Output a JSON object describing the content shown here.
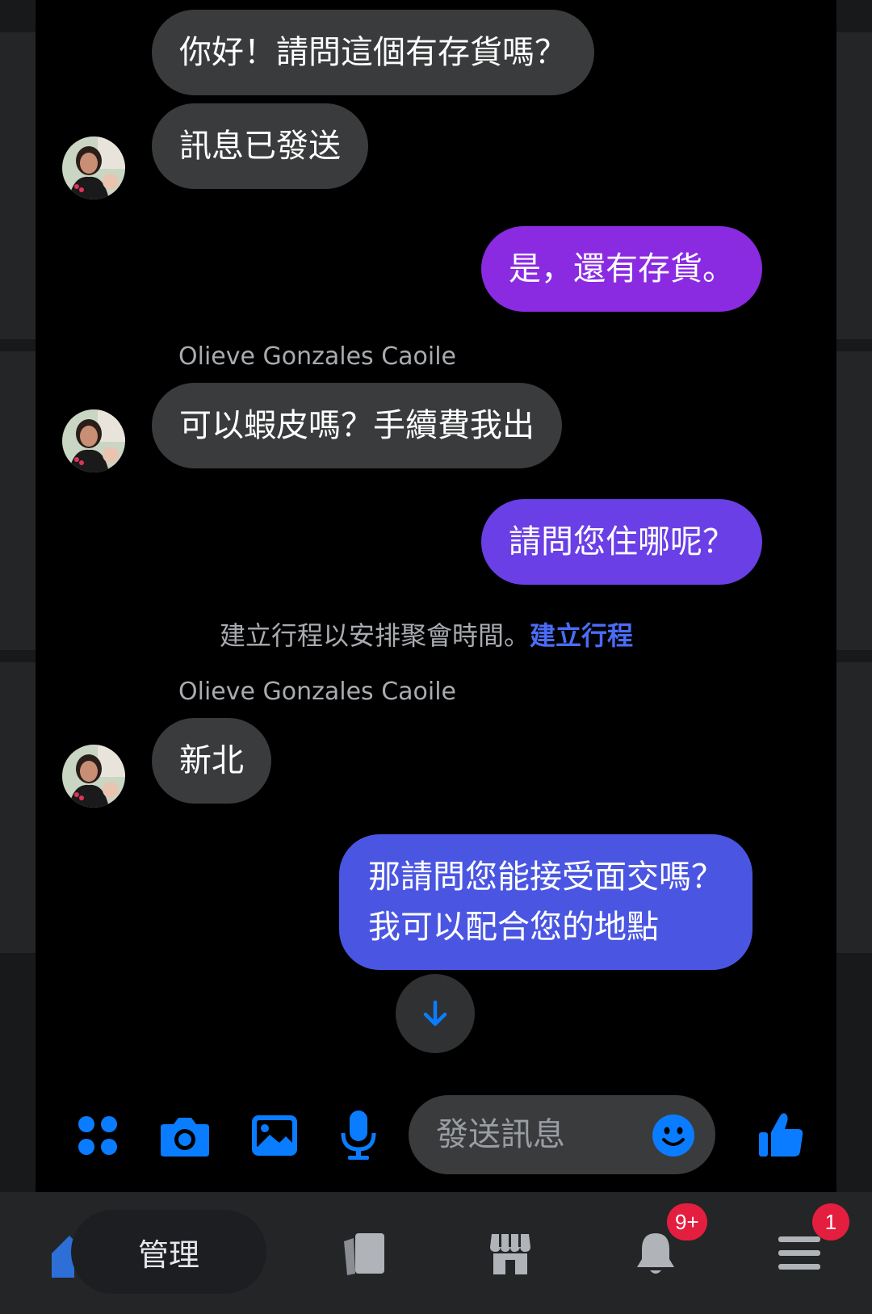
{
  "conversation": {
    "messages": [
      {
        "direction": "in",
        "text": "你好！請問這個有存貨嗎？"
      },
      {
        "direction": "in",
        "text": "訊息已發送"
      },
      {
        "direction": "out",
        "text": "是，還有存貨。"
      },
      {
        "direction": "in",
        "sender": "Olieve Gonzales Caoile",
        "text": "可以蝦皮嗎？手續費我出"
      },
      {
        "direction": "out",
        "text": "請問您住哪呢？"
      },
      {
        "direction": "in",
        "sender": "Olieve Gonzales Caoile",
        "text": "新北"
      },
      {
        "direction": "out",
        "text_line1": "那請問您能接受面交嗎？",
        "text_line2": "我可以配合您的地點"
      }
    ],
    "system_note": {
      "text": "建立行程以安排聚會時間。",
      "link": "建立行程"
    }
  },
  "composer": {
    "placeholder": "發送訊息",
    "icons": [
      "apps-icon",
      "camera-icon",
      "image-icon",
      "microphone-icon",
      "emoji-icon",
      "thumbs-up-icon"
    ]
  },
  "bottom_nav": {
    "manage_label": "管理",
    "notifications_badge": "9+",
    "menu_badge": "1"
  },
  "colors": {
    "accent": "#0a7cff",
    "incoming_bubble": "#3a3b3c",
    "outgoing_top": "#8a2be2",
    "outgoing_bottom": "#4a56e2",
    "badge": "#e41e3f"
  }
}
